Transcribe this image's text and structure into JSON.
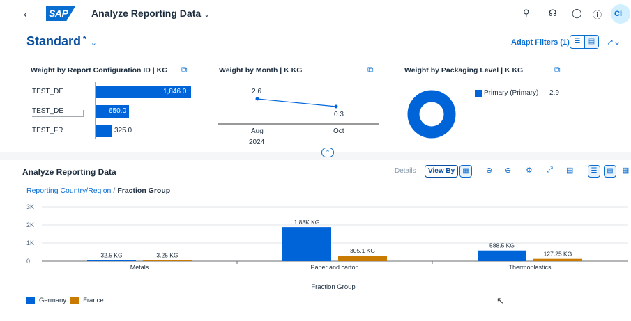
{
  "shell": {
    "back_icon": "chevron-left-icon",
    "logo_text": "SAP",
    "app_title": "Analyze Reporting Data",
    "avatar_initials": "CI",
    "icons": [
      "search-icon",
      "headset-icon",
      "chat-icon",
      "help-icon"
    ]
  },
  "header": {
    "variant_name": "Standard",
    "variant_modified": "*",
    "adapt_filters": "Adapt Filters (1)"
  },
  "cards": [
    {
      "title": "Weight by Report Configuration ID | KG",
      "rows": [
        {
          "label": "TEST_DE",
          "value": "1,846.0"
        },
        {
          "label": "TEST_DE",
          "value": "650.0"
        },
        {
          "label": "TEST_FR",
          "value": "325.0"
        }
      ]
    },
    {
      "title": "Weight by Month | K KG",
      "points": [
        {
          "x": "Aug",
          "value": "2.6"
        },
        {
          "x": "Oct",
          "value": "0.3"
        }
      ],
      "year": "2024"
    },
    {
      "title": "Weight by Packaging Level | K KG",
      "legend_label": "Primary (Primary)",
      "legend_value": "2.9"
    }
  ],
  "section": {
    "title": "Analyze Reporting Data",
    "details": "Details",
    "view_by": "View By",
    "breadcrumb_link": "Reporting Country/Region",
    "breadcrumb_current": "Fraction Group"
  },
  "colors": {
    "germany": "#0064d9",
    "france": "#c87b00",
    "accent": "#0a6ed1"
  },
  "chart_data": {
    "type": "bar",
    "categories": [
      "Metals",
      "Paper and carton",
      "Thermoplastics"
    ],
    "series": [
      {
        "name": "Germany",
        "values": [
          32.5,
          1880,
          588.5
        ],
        "labels": [
          "32.5 KG",
          "1.88K KG",
          "588.5 KG"
        ]
      },
      {
        "name": "France",
        "values": [
          3.25,
          305.1,
          127.25
        ],
        "labels": [
          "3.25 KG",
          "305.1 KG",
          "127.25 KG"
        ]
      }
    ],
    "yticks": [
      "0",
      "1K",
      "2K",
      "3K"
    ],
    "ylim": [
      0,
      3000
    ],
    "xlabel": "Fraction Group",
    "legend_position": "bottom-left"
  }
}
